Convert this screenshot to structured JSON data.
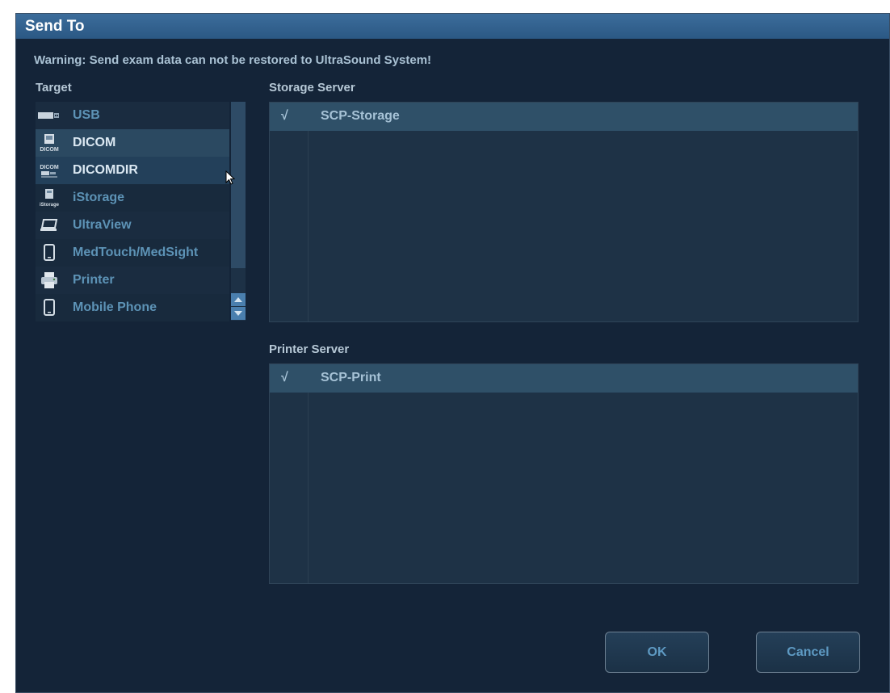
{
  "dialog": {
    "title": "Send To",
    "warning": "Warning: Send exam data can not be restored to UltraSound System!"
  },
  "target": {
    "label": "Target",
    "items": [
      {
        "label": "USB",
        "icon": "usb-drive-icon"
      },
      {
        "label": "DICOM",
        "icon": "dicom-icon",
        "icon_text": "DICOM"
      },
      {
        "label": "DICOMDIR",
        "icon": "dicomdir-icon",
        "icon_text": "DICOM"
      },
      {
        "label": "iStorage",
        "icon": "istorage-icon",
        "icon_text": "iStorage"
      },
      {
        "label": "UltraView",
        "icon": "laptop-icon"
      },
      {
        "label": "MedTouch/MedSight",
        "icon": "tablet-icon"
      },
      {
        "label": "Printer",
        "icon": "printer-icon"
      },
      {
        "label": "Mobile Phone",
        "icon": "mobile-phone-icon"
      }
    ],
    "selected": "DICOM"
  },
  "storage_server": {
    "label": "Storage Server",
    "rows": [
      {
        "checked": "√",
        "name": "SCP-Storage"
      }
    ]
  },
  "printer_server": {
    "label": "Printer Server",
    "rows": [
      {
        "checked": "√",
        "name": "SCP-Print"
      }
    ]
  },
  "buttons": {
    "ok": "OK",
    "cancel": "Cancel"
  },
  "colors": {
    "background": "#142438",
    "title_bar": "#2b5884",
    "accent_text": "#5d93b6"
  }
}
